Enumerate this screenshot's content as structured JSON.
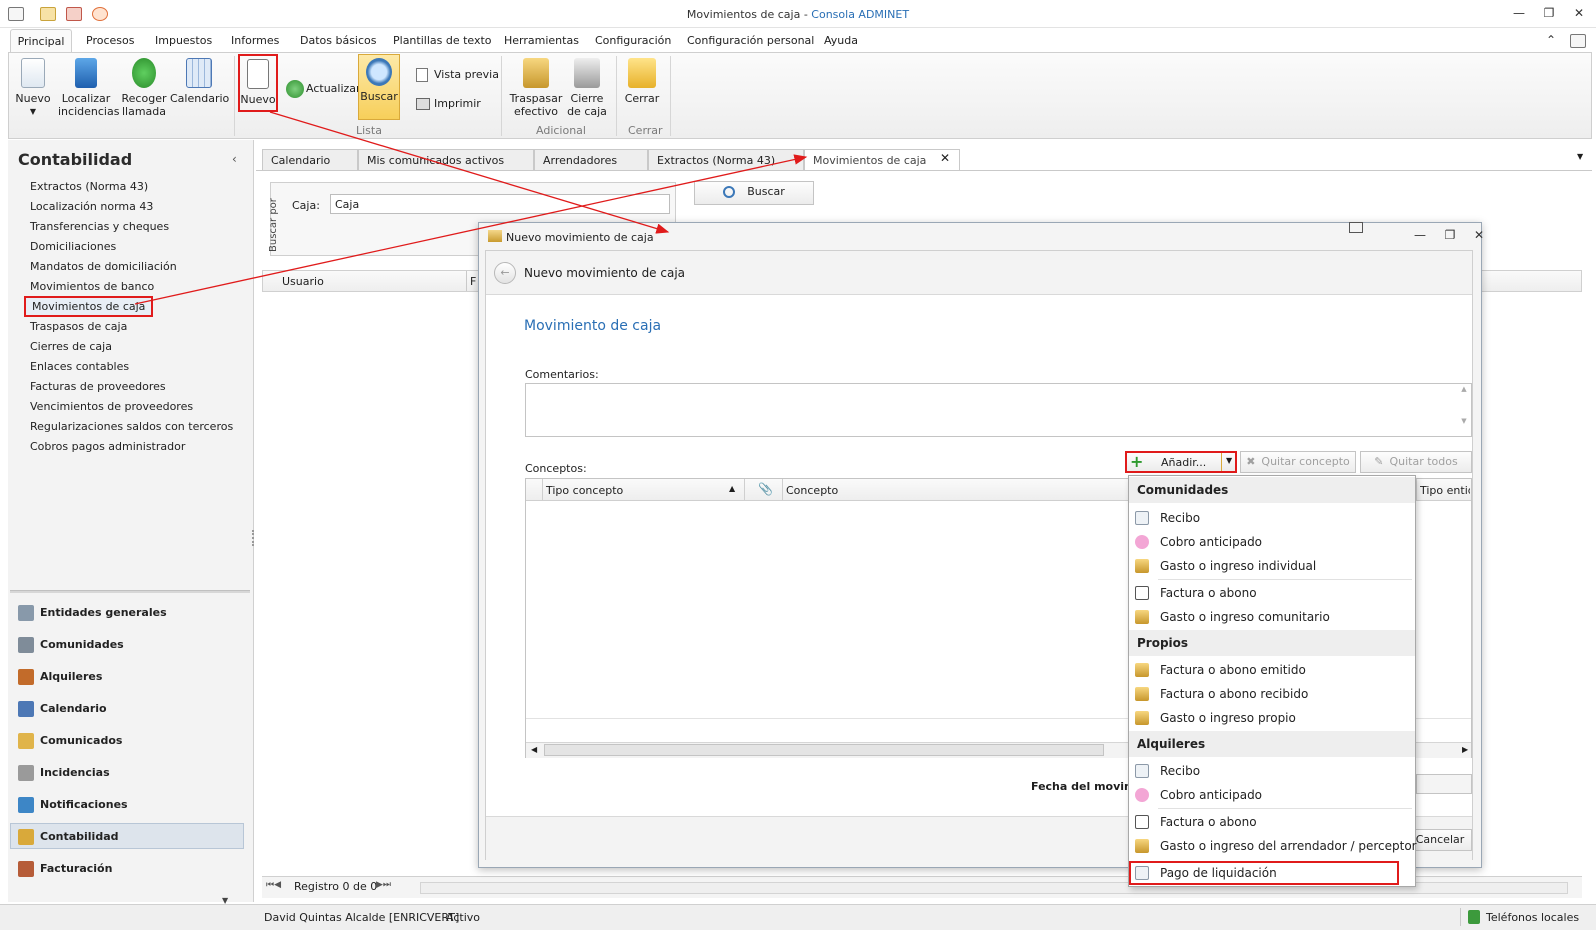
{
  "window": {
    "title": "Movimientos de caja",
    "title_sep": " - ",
    "app_name": "Consola ADMINET"
  },
  "menu": {
    "tabs": [
      "Principal",
      "Procesos",
      "Impuestos",
      "Informes",
      "Datos básicos",
      "Plantillas de texto",
      "Herramientas",
      "Configuración",
      "Configuración personal",
      "Ayuda"
    ]
  },
  "ribbon": {
    "nuevo_left": "Nuevo",
    "localizar": "Localizar incidencias",
    "localizar_1": "Localizar",
    "localizar_2": "incidencias",
    "recoger_1": "Recoger",
    "recoger_2": "llamada",
    "calendario": "Calendario",
    "nuevo": "Nuevo",
    "actualizar": "Actualizar",
    "buscar": "Buscar",
    "vista_previa": "Vista previa",
    "imprimir": "Imprimir",
    "traspasar_1": "Traspasar",
    "traspasar_2": "efectivo",
    "cierre_1": "Cierre",
    "cierre_2": "de caja",
    "cerrar": "Cerrar",
    "group_lista": "Lista",
    "group_adicional": "Adicional",
    "group_cerrar": "Cerrar"
  },
  "sidebar": {
    "title": "Contabilidad",
    "items": [
      "Extractos (Norma 43)",
      "Localización norma 43",
      "Transferencias y cheques",
      "Domiciliaciones",
      "Mandatos de domiciliación",
      "Movimientos de banco",
      "Movimientos de caja",
      "Traspasos de caja",
      "Cierres de caja",
      "Enlaces contables",
      "Facturas de proveedores",
      "Vencimientos de proveedores",
      "Regularizaciones saldos con terceros",
      "Cobros pagos administrador"
    ],
    "sections": [
      "Entidades generales",
      "Comunidades",
      "Alquileres",
      "Calendario",
      "Comunicados",
      "Incidencias",
      "Notificaciones",
      "Contabilidad",
      "Facturación"
    ]
  },
  "doc_tabs": [
    "Calendario",
    "Mis comunicados activos",
    "Arrendadores",
    "Extractos (Norma 43)",
    "Movimientos de caja"
  ],
  "search": {
    "buscar_por": "Buscar por",
    "caja_label": "Caja:",
    "caja_value": "Caja",
    "buscar_button": "Buscar"
  },
  "grid_bg": {
    "col_usuario": "Usuario",
    "col_f": "F",
    "registro": "Registro 0 de 0"
  },
  "dialog": {
    "window_title": "Nuevo movimiento de caja",
    "header": "Nuevo movimiento de caja",
    "section_title": "Movimiento de caja",
    "comentarios_label": "Comentarios:",
    "conceptos_label": "Conceptos:",
    "anadir": "Añadir...",
    "quitar_concepto": "Quitar concepto",
    "quitar_todos": "Quitar todos",
    "col_tipo_concepto": "Tipo concepto",
    "col_concepto": "Concepto",
    "col_tipo_entidad": "Tipo entida",
    "fecha_label": "Fecha del movim",
    "cancelar": "Cancelar"
  },
  "dropdown": {
    "comunidades": {
      "header": "Comunidades",
      "items": [
        "Recibo",
        "Cobro anticipado",
        "Gasto o ingreso individual",
        "Factura o abono",
        "Gasto o ingreso comunitario"
      ]
    },
    "propios": {
      "header": "Propios",
      "items": [
        "Factura o abono emitido",
        "Factura o abono recibido",
        "Gasto o ingreso propio"
      ]
    },
    "alquileres": {
      "header": "Alquileres",
      "items": [
        "Recibo",
        "Cobro anticipado",
        "Factura o abono",
        "Gasto o ingreso del arrendador / perceptor",
        "Pago de liquidación"
      ]
    }
  },
  "status": {
    "user": "David Quintas Alcalde [ENRICVERT]",
    "state": "Activo",
    "telefonos": "Teléfonos locales"
  },
  "colors": {
    "accent": "#2a6fb5",
    "highlight": "#e01b1b"
  }
}
